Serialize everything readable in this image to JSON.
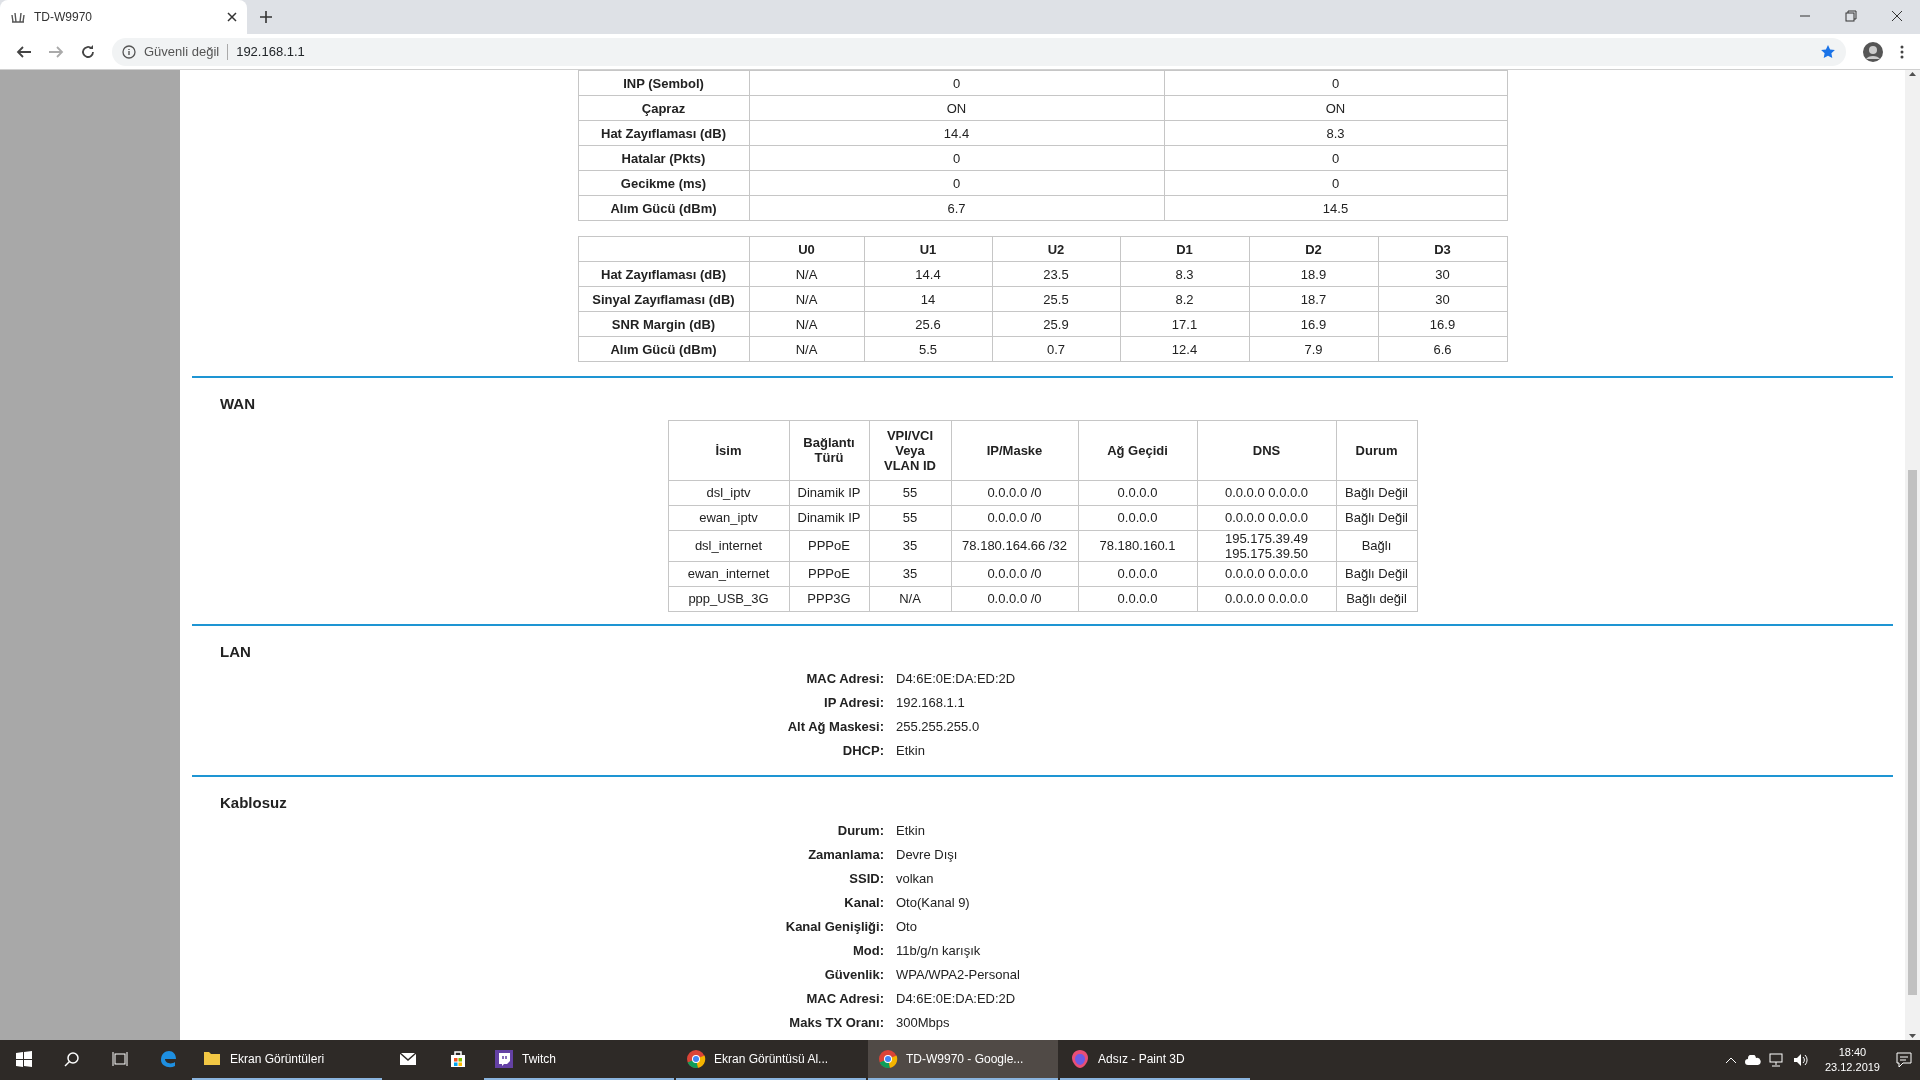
{
  "browser": {
    "tab_title": "TD-W9970",
    "security_label": "Güvenli değil",
    "url": "192.168.1.1"
  },
  "dsl_table": {
    "rows": [
      {
        "label": "INP (Sembol)",
        "values": [
          "0",
          "0"
        ]
      },
      {
        "label": "Çapraz",
        "values": [
          "ON",
          "ON"
        ]
      },
      {
        "label": "Hat Zayıflaması (dB)",
        "values": [
          "14.4",
          "8.3"
        ]
      },
      {
        "label": "Hatalar (Pkts)",
        "values": [
          "0",
          "0"
        ]
      },
      {
        "label": "Gecikme (ms)",
        "values": [
          "0",
          "0"
        ]
      },
      {
        "label": "Alım Gücü (dBm)",
        "values": [
          "6.7",
          "14.5"
        ]
      }
    ]
  },
  "band_table": {
    "columns": [
      "U0",
      "U1",
      "U2",
      "D1",
      "D2",
      "D3"
    ],
    "rows": [
      {
        "label": "Hat Zayıflaması (dB)",
        "values": [
          "N/A",
          "14.4",
          "23.5",
          "8.3",
          "18.9",
          "30"
        ]
      },
      {
        "label": "Sinyal Zayıflaması (dB)",
        "values": [
          "N/A",
          "14",
          "25.5",
          "8.2",
          "18.7",
          "30"
        ]
      },
      {
        "label": "SNR Margin (dB)",
        "values": [
          "N/A",
          "25.6",
          "25.9",
          "17.1",
          "16.9",
          "16.9"
        ]
      },
      {
        "label": "Alım Gücü (dBm)",
        "values": [
          "N/A",
          "5.5",
          "0.7",
          "12.4",
          "7.9",
          "6.6"
        ]
      }
    ]
  },
  "sections": [
    {
      "title": "WAN",
      "kind": "table",
      "columns": [
        "İsim",
        "Bağlantı Türü",
        "VPI/VCI Veya VLAN ID",
        "IP/Maske",
        "Ağ Geçidi",
        "DNS",
        "Durum"
      ],
      "rows": [
        [
          "dsl_iptv",
          "Dinamik IP",
          "55",
          "0.0.0.0 /0",
          "0.0.0.0",
          "0.0.0.0 0.0.0.0",
          "Bağlı Değil"
        ],
        [
          "ewan_iptv",
          "Dinamik IP",
          "55",
          "0.0.0.0 /0",
          "0.0.0.0",
          "0.0.0.0 0.0.0.0",
          "Bağlı Değil"
        ],
        [
          "dsl_internet",
          "PPPoE",
          "35",
          "78.180.164.66 /32",
          "78.180.160.1",
          "195.175.39.49\n195.175.39.50",
          "Bağlı"
        ],
        [
          "ewan_internet",
          "PPPoE",
          "35",
          "0.0.0.0 /0",
          "0.0.0.0",
          "0.0.0.0 0.0.0.0",
          "Bağlı Değil"
        ],
        [
          "ppp_USB_3G",
          "PPP3G",
          "N/A",
          "0.0.0.0 /0",
          "0.0.0.0",
          "0.0.0.0 0.0.0.0",
          "Bağlı değil"
        ]
      ]
    },
    {
      "title": "LAN",
      "kind": "fields",
      "fields": [
        {
          "label": "MAC Adresi:",
          "value": "D4:6E:0E:DA:ED:2D"
        },
        {
          "label": "IP Adresi:",
          "value": "192.168.1.1"
        },
        {
          "label": "Alt Ağ Maskesi:",
          "value": "255.255.255.0"
        },
        {
          "label": "DHCP:",
          "value": "Etkin"
        }
      ]
    },
    {
      "title": "Kablosuz",
      "kind": "fields",
      "fields": [
        {
          "label": "Durum:",
          "value": "Etkin"
        },
        {
          "label": "Zamanlama:",
          "value": "Devre Dışı"
        },
        {
          "label": "SSID:",
          "value": "volkan"
        },
        {
          "label": "Kanal:",
          "value": "Oto(Kanal 9)"
        },
        {
          "label": "Kanal Genişliği:",
          "value": "Oto"
        },
        {
          "label": "Mod:",
          "value": "11b/g/n karışık"
        },
        {
          "label": "Güvenlik:",
          "value": "WPA/WPA2-Personal"
        },
        {
          "label": "MAC Adresi:",
          "value": "D4:6E:0E:DA:ED:2D"
        },
        {
          "label": "Maks TX Oranı:",
          "value": "300Mbps"
        }
      ]
    }
  ],
  "taskbar": {
    "items": [
      {
        "kind": "folder",
        "label": "Ekran Görüntüleri",
        "running": true,
        "selected": false
      },
      {
        "kind": "mail",
        "running": false,
        "selected": false
      },
      {
        "kind": "store",
        "running": false,
        "selected": false
      },
      {
        "kind": "twitch",
        "label": "Twitch",
        "running": true,
        "selected": false
      },
      {
        "kind": "chrome",
        "label": "Ekran Görüntüsü Al...",
        "running": true,
        "selected": false
      },
      {
        "kind": "chrome",
        "label": "TD-W9970 - Google...",
        "running": true,
        "selected": true
      },
      {
        "kind": "paint",
        "label": "Adsız - Paint 3D",
        "running": true,
        "selected": false
      }
    ],
    "time": "18:40",
    "date": "23.12.2019"
  }
}
